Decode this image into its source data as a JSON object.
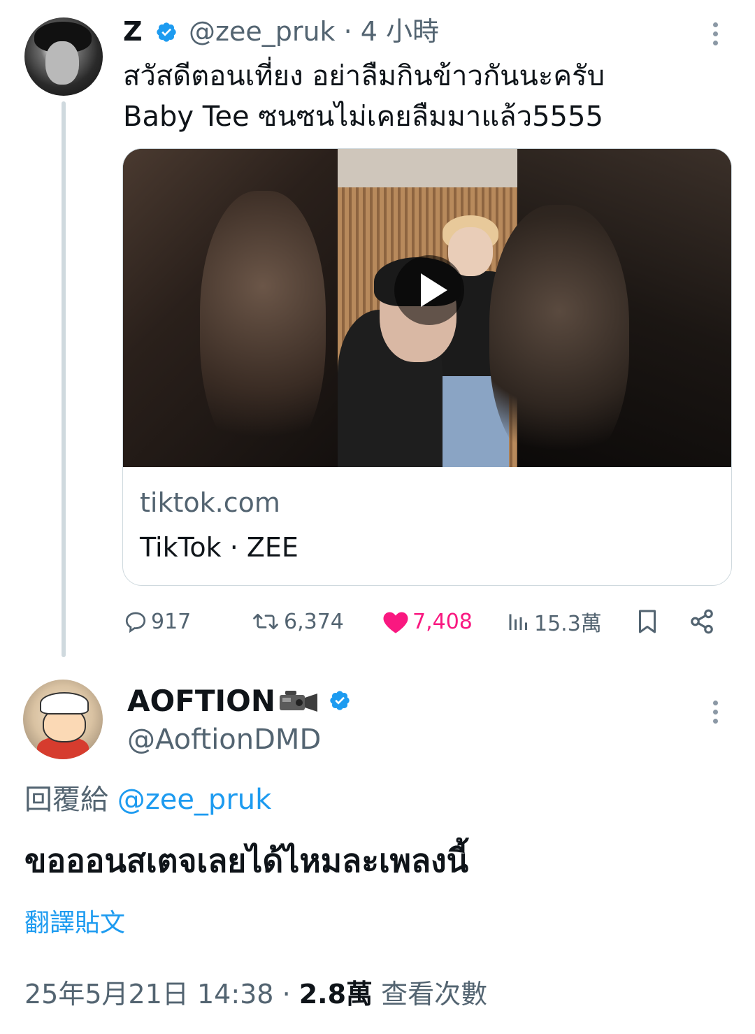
{
  "parent_tweet": {
    "display_name": "Z",
    "handle": "@zee_pruk",
    "time": "· 4 小時",
    "text_line1": "สวัสดีตอนเที่ยง อย่าลืมกินข้าวกันนะครับ",
    "text_line2": "Baby Tee ซนซนไม่เคยลืมมาแล้ว5555",
    "card": {
      "domain": "tiktok.com",
      "title": "TikTok · ZEE"
    },
    "stats": {
      "replies": "917",
      "retweets": "6,374",
      "likes": "7,408",
      "views": "15.3萬"
    }
  },
  "reply_tweet": {
    "display_name": "AOFTION",
    "emoji": "📹",
    "handle": "@AoftionDMD",
    "reply_to_label": "回覆給",
    "reply_to_handle": "@zee_pruk",
    "text": "ขอออนสเตจเลยได้ไหมละเพลงนี้",
    "translate_label": "翻譯貼文",
    "timestamp": "25年5月21日 14:38",
    "separator": " · ",
    "view_count": "2.8萬",
    "view_label": " 查看次數"
  },
  "colors": {
    "accent": "#1d9bf0",
    "like": "#f91880",
    "secondary_text": "#536471"
  },
  "icons": [
    "verified-badge-icon",
    "more-options-icon",
    "play-icon",
    "reply-icon",
    "retweet-icon",
    "heart-icon",
    "views-icon",
    "bookmark-icon",
    "share-icon",
    "video-camera-icon"
  ]
}
